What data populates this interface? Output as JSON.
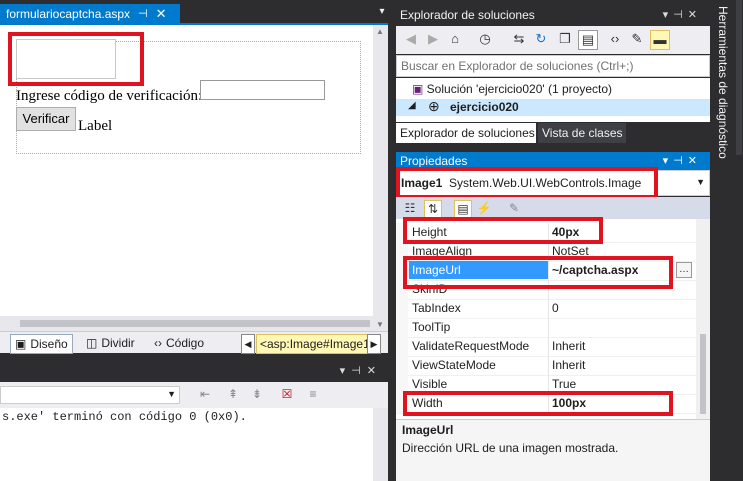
{
  "document_tab": {
    "title": "formulariocaptcha.aspx",
    "pin": "⊣",
    "close": "✕"
  },
  "designer": {
    "label_code": "Ingrese código de verificación:",
    "verify_button": "Verificar",
    "label_text": "Label"
  },
  "view_bar": {
    "design": "Diseño",
    "split": "Dividir",
    "code": "Código",
    "tag_path": "<asp:Image#Image1"
  },
  "output": {
    "text": "s.exe' terminó con código 0 (0x0)."
  },
  "solution_explorer": {
    "title": "Explorador de soluciones",
    "search_placeholder": "Buscar en Explorador de soluciones (Ctrl+;)",
    "solution_item": "Solución 'ejercicio020'  (1 proyecto)",
    "project_item": "ejercicio020",
    "tab_active": "Explorador de soluciones",
    "tab_other": "Vista de clases"
  },
  "properties": {
    "title": "Propiedades",
    "object_name": "Image1",
    "object_type": "System.Web.UI.WebControls.Image",
    "rows": [
      {
        "name": "Height",
        "value": "40px",
        "bold": true
      },
      {
        "name": "ImageAlign",
        "value": "NotSet",
        "bold": false
      },
      {
        "name": "ImageUrl",
        "value": "~/captcha.aspx",
        "bold": true
      },
      {
        "name": "SkinID",
        "value": "",
        "bold": false
      },
      {
        "name": "TabIndex",
        "value": "0",
        "bold": false
      },
      {
        "name": "ToolTip",
        "value": "",
        "bold": false
      },
      {
        "name": "ValidateRequestMode",
        "value": "Inherit",
        "bold": false
      },
      {
        "name": "ViewStateMode",
        "value": "Inherit",
        "bold": false
      },
      {
        "name": "Visible",
        "value": "True",
        "bold": false
      },
      {
        "name": "Width",
        "value": "100px",
        "bold": true
      }
    ],
    "description_title": "ImageUrl",
    "description_text": "Dirección URL de una imagen mostrada."
  },
  "right_rail": {
    "label": "Herramientas de diagnóstico"
  },
  "colors": {
    "accent": "#007acc",
    "highlight_box": "#e0141e",
    "selection": "#3399ff"
  }
}
